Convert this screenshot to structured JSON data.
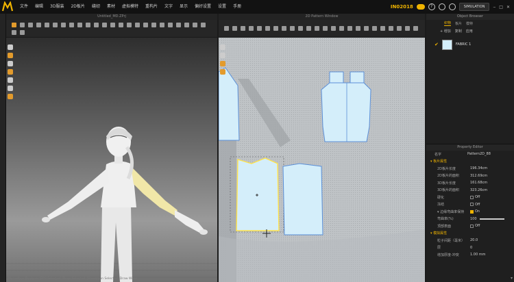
{
  "menubar": {
    "logo_letter": "M",
    "items": [
      "文件",
      "编辑",
      "3D服装",
      "2D板片",
      "缝纫",
      "素材",
      "虚拟模特",
      "重构片",
      "文字",
      "显示",
      "偏好设置",
      "设置",
      "手册"
    ],
    "bn_id": "IN02018",
    "help": "?",
    "simulation_label": "SIMULATION"
  },
  "viewport3d": {
    "title": "Untitled_MD.ZPrj",
    "status": "Marvelous Designer  GPU Selected, Draw Selected, Simulation Selected, Draw Wires"
  },
  "viewport2d": {
    "title": "2D Pattern Window"
  },
  "object_browser": {
    "title": "Object Browser",
    "tabs": [
      "织物",
      "板片",
      "模特"
    ],
    "add_label": "+ 增加",
    "copy_label": "复制",
    "apply_label": "应用",
    "fabric_name": "FABRIC 1",
    "fabric_color": "#d4eefa"
  },
  "property_editor": {
    "title": "Property Editor",
    "rows": [
      {
        "label": "名字",
        "value": "Pattern2D_88"
      },
      {
        "label": "▾ 板片属性",
        "value": "",
        "section": true
      },
      {
        "label": "2D板片长度",
        "value": "196.34cm",
        "sub": true
      },
      {
        "label": "2D板片的面积",
        "value": "312.69cm",
        "sub": true
      },
      {
        "label": "3D板片长度",
        "value": "161.68cm",
        "sub": true
      },
      {
        "label": "3D板片的面积",
        "value": "323.26cm",
        "sub": true
      },
      {
        "label": "硬化",
        "value": "Off",
        "sub": true,
        "check": false
      },
      {
        "label": "冻结",
        "value": "Off",
        "sub": true,
        "check": false
      },
      {
        "label": "▾ 边缘弯曲率保持",
        "value": "On",
        "sub": true,
        "check": true
      },
      {
        "label": "弯曲率(%)",
        "value": "100",
        "sub": true,
        "slider": 1.0
      },
      {
        "label": "顶部表面",
        "value": "Off",
        "sub": true,
        "check": false
      },
      {
        "label": "▾ 模拟属性",
        "value": "",
        "section": true
      },
      {
        "label": "粒子间距（毫米）",
        "value": "20.0",
        "sub": true
      },
      {
        "label": "层",
        "value": "0",
        "sub": true
      },
      {
        "label": "增加厚度-冲突",
        "value": "1.00 mm",
        "sub": true
      }
    ]
  },
  "colors": {
    "accent": "#f0b400",
    "pattern_fill": "#d4eefa",
    "pattern_stroke": "#5a8fd8",
    "selected_stroke": "#ffe34a"
  }
}
